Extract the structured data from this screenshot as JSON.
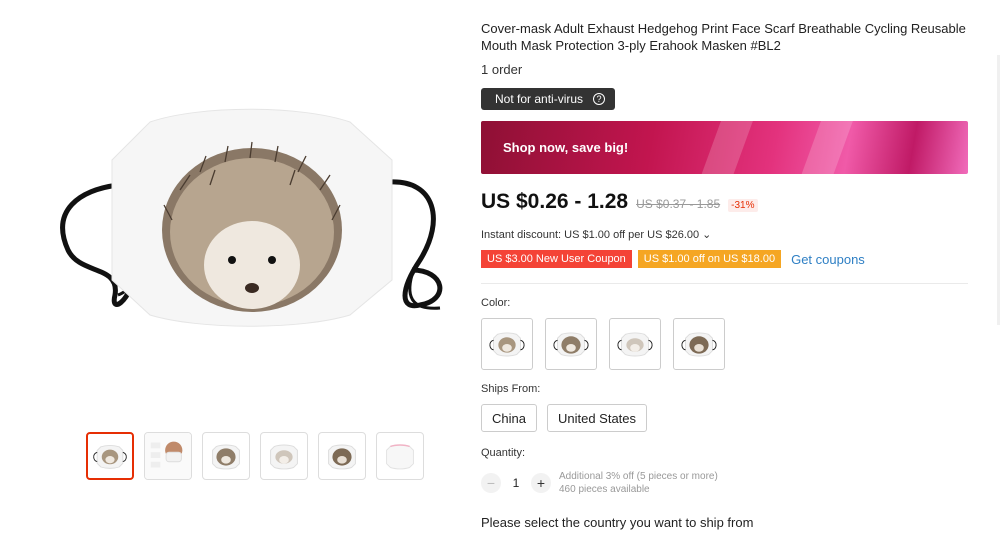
{
  "product": {
    "title": "Cover-mask Adult Exhaust Hedgehog Print Face Scarf Breathable Cycling Reusable Mouth Mask Protection 3-ply Erahook Masken #BL2",
    "orders": "1 order",
    "notice": "Not for anti-virus",
    "banner": "Shop now, save big!",
    "price": "US $0.26 - 1.28",
    "original_price": "US $0.37 - 1.85",
    "discount": "-31%",
    "instant_discount": "Instant discount: US $1.00 off per US $26.00 ⌄",
    "coupons": [
      {
        "label": "US $3.00 New User Coupon",
        "color": "#f44336"
      },
      {
        "label": "US $1.00 off on US $18.00",
        "color": "#f5a623"
      }
    ],
    "get_coupons": "Get coupons"
  },
  "options": {
    "color_label": "Color:",
    "color_count": 4,
    "ships_from_label": "Ships From:",
    "ships_from": [
      "China",
      "United States"
    ]
  },
  "quantity": {
    "label": "Quantity:",
    "value": "1",
    "minus": "−",
    "plus": "+",
    "offer": "Additional 3% off (5 pieces or more)",
    "available": "460 pieces available"
  },
  "ship_message": "Please select the country you want to ship from",
  "gallery": {
    "thumbnail_count": 6,
    "selected_index": 0
  },
  "colors": {
    "accent_red": "#e62e04",
    "link_blue": "#2e7fc4"
  },
  "icons": {
    "help": "question-circle-icon",
    "chevron": "chevron-down-icon"
  }
}
